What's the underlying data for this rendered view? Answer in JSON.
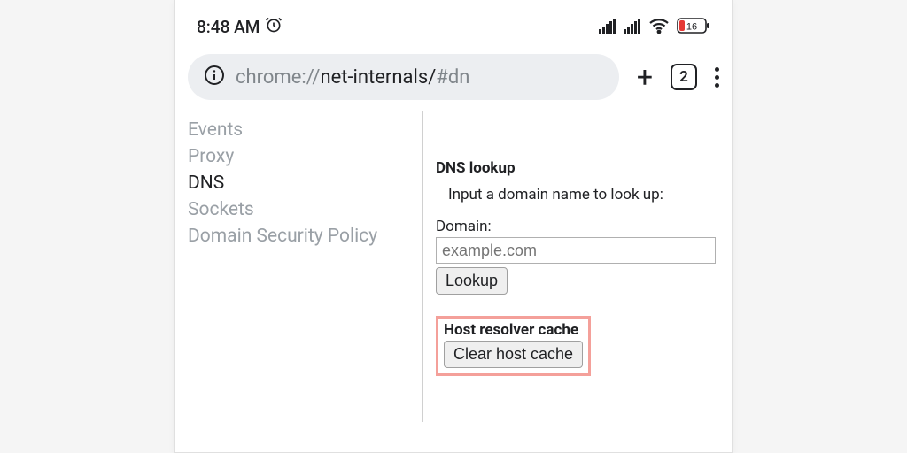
{
  "status": {
    "time": "8:48 AM",
    "battery_percent": "16"
  },
  "browser": {
    "url_prefix": "chrome://",
    "url_path": "net-internals/",
    "url_hash": "#dn",
    "tab_count": "2"
  },
  "sidebar": {
    "items": [
      {
        "label": "Events"
      },
      {
        "label": "Proxy"
      },
      {
        "label": "DNS"
      },
      {
        "label": "Sockets"
      },
      {
        "label": "Domain Security Policy"
      }
    ]
  },
  "main": {
    "dns_lookup": {
      "title": "DNS lookup",
      "desc": "Input a domain name to look up:",
      "field_label": "Domain:",
      "placeholder": "example.com",
      "lookup_button": "Lookup"
    },
    "host_cache": {
      "title": "Host resolver cache",
      "clear_button": "Clear host cache"
    }
  },
  "colors": {
    "highlight": "#f4a09a"
  }
}
